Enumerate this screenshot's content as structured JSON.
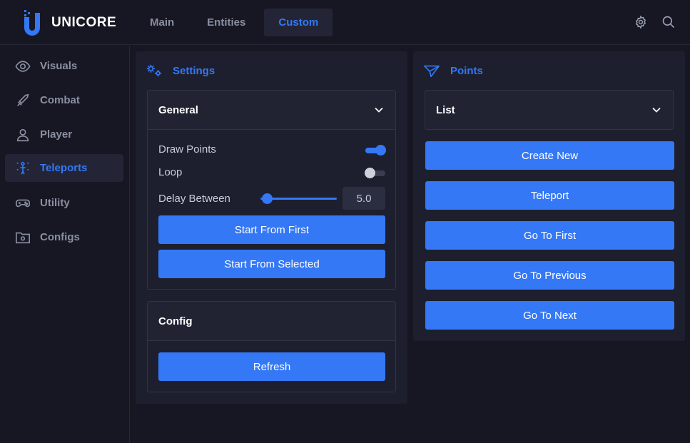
{
  "app": {
    "name": "UNICORE"
  },
  "nav": {
    "tabs": [
      {
        "label": "Main",
        "active": false
      },
      {
        "label": "Entities",
        "active": false
      },
      {
        "label": "Custom",
        "active": true
      }
    ]
  },
  "top_icons": [
    "gear-icon",
    "search-icon"
  ],
  "sidebar": {
    "items": [
      {
        "label": "Visuals",
        "icon": "eye-icon",
        "active": false
      },
      {
        "label": "Combat",
        "icon": "sword-icon",
        "active": false
      },
      {
        "label": "Player",
        "icon": "user-icon",
        "active": false
      },
      {
        "label": "Teleports",
        "icon": "teleport-icon",
        "active": true
      },
      {
        "label": "Utility",
        "icon": "gamepad-icon",
        "active": false
      },
      {
        "label": "Configs",
        "icon": "folder-gear-icon",
        "active": false
      }
    ]
  },
  "settings": {
    "title": "Settings",
    "general": {
      "title": "General",
      "draw_points": {
        "label": "Draw Points",
        "on": true
      },
      "loop": {
        "label": "Loop",
        "on": false
      },
      "delay": {
        "label": "Delay Between",
        "value": "5.0",
        "fraction": 0.02
      },
      "start_first": "Start From First",
      "start_selected": "Start From Selected"
    },
    "config": {
      "title": "Config",
      "refresh": "Refresh"
    }
  },
  "points": {
    "title": "Points",
    "list_select": "List",
    "buttons": {
      "create_new": "Create New",
      "teleport": "Teleport",
      "go_first": "Go To First",
      "go_previous": "Go To Previous",
      "go_next": "Go To Next"
    }
  },
  "colors": {
    "accent": "#3478f6",
    "background": "#161722",
    "panel": "#1d1f2e",
    "text_muted": "#8b8fa3"
  }
}
